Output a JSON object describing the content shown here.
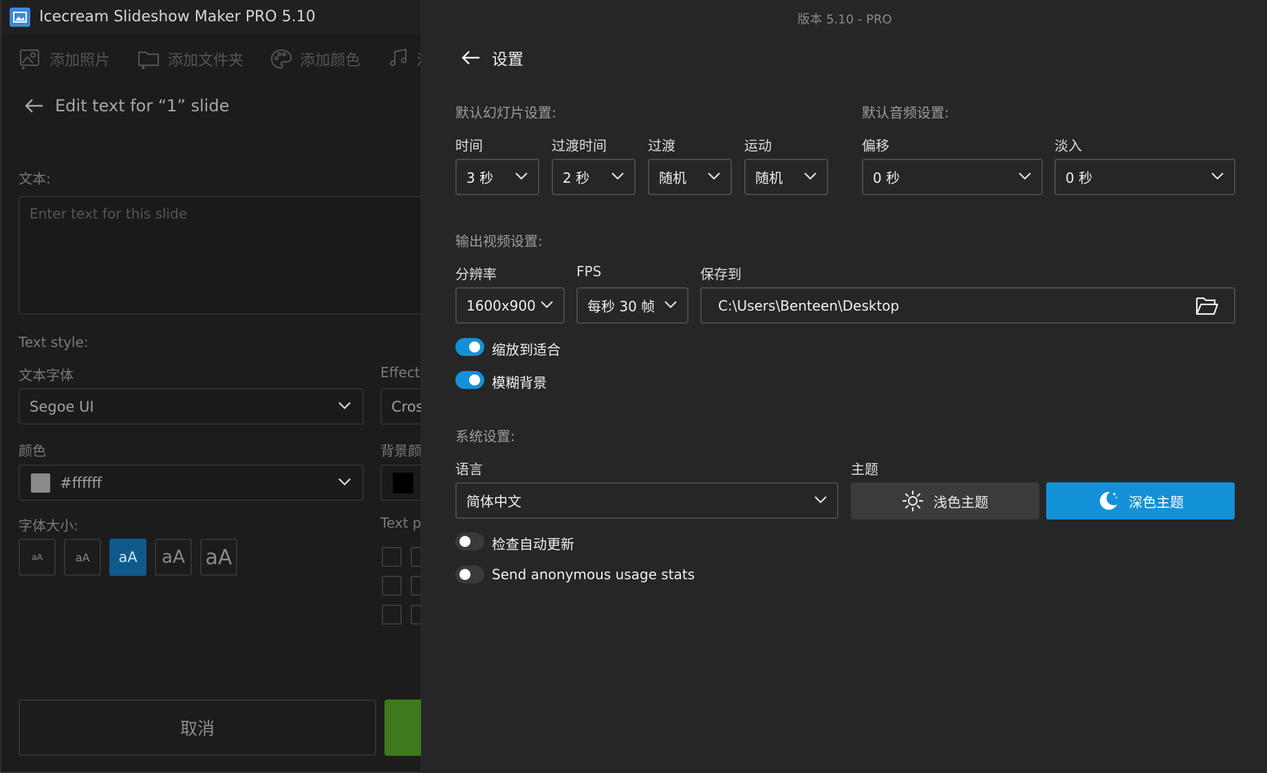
{
  "left": {
    "title": "Icecream Slideshow Maker PRO 5.10",
    "toolbar": [
      {
        "label": "添加照片",
        "icon": "add-photo-icon"
      },
      {
        "label": "添加文件夹",
        "icon": "add-folder-icon"
      },
      {
        "label": "添加颜色",
        "icon": "palette-icon"
      },
      {
        "label": "添",
        "icon": "add-music-icon"
      }
    ],
    "edit_title": "Edit text for “1” slide",
    "text_label": "文本:",
    "text_placeholder": "Enter text for this slide",
    "text_style_label": "Text style:",
    "font_label": "文本字体",
    "font_value": "Segoe UI",
    "effect_label": "Effect",
    "effect_value": "Cros",
    "color_label": "颜色",
    "color_value": "#ffffff",
    "color_swatch": "#ffffff",
    "bg_color_label": "背景颜",
    "bg_swatch": "#000000",
    "font_size_label": "字体大小:",
    "text_pos_label": "Text po",
    "sizes": [
      "aA",
      "aA",
      "aA",
      "aA",
      "aA"
    ],
    "active_size_index": 2,
    "cancel": "取消"
  },
  "settings": {
    "version": "版本 5.10 - PRO",
    "title": "设置",
    "slide_section": "默认幻灯片设置:",
    "audio_section": "默认音频设置:",
    "duration": {
      "label": "时间",
      "value": "3 秒"
    },
    "transition_time": {
      "label": "过渡时间",
      "value": "2 秒"
    },
    "transition": {
      "label": "过渡",
      "value": "随机"
    },
    "motion": {
      "label": "运动",
      "value": "随机"
    },
    "offset": {
      "label": "偏移",
      "value": "0 秒"
    },
    "fade_in": {
      "label": "淡入",
      "value": "0 秒"
    },
    "output_section": "输出视频设置:",
    "resolution": {
      "label": "分辨率",
      "value": "1600x900"
    },
    "fps": {
      "label": "FPS",
      "value": "每秒 30 帧"
    },
    "save_to": {
      "label": "保存到",
      "value": "C:\\Users\\Benteen\\Desktop"
    },
    "scale_to_fit": {
      "label": "缩放到适合",
      "on": true
    },
    "blur_background": {
      "label": "模糊背景",
      "on": true
    },
    "system_section": "系统设置:",
    "language": {
      "label": "语言",
      "value": "简体中文"
    },
    "theme": {
      "label": "主题",
      "light": "浅色主题",
      "dark": "深色主题",
      "selected": "dark"
    },
    "auto_update": {
      "label": "检查自动更新",
      "on": false
    },
    "usage_stats": {
      "label": "Send anonymous usage stats",
      "on": false
    },
    "accent_color": "#1391d8"
  }
}
